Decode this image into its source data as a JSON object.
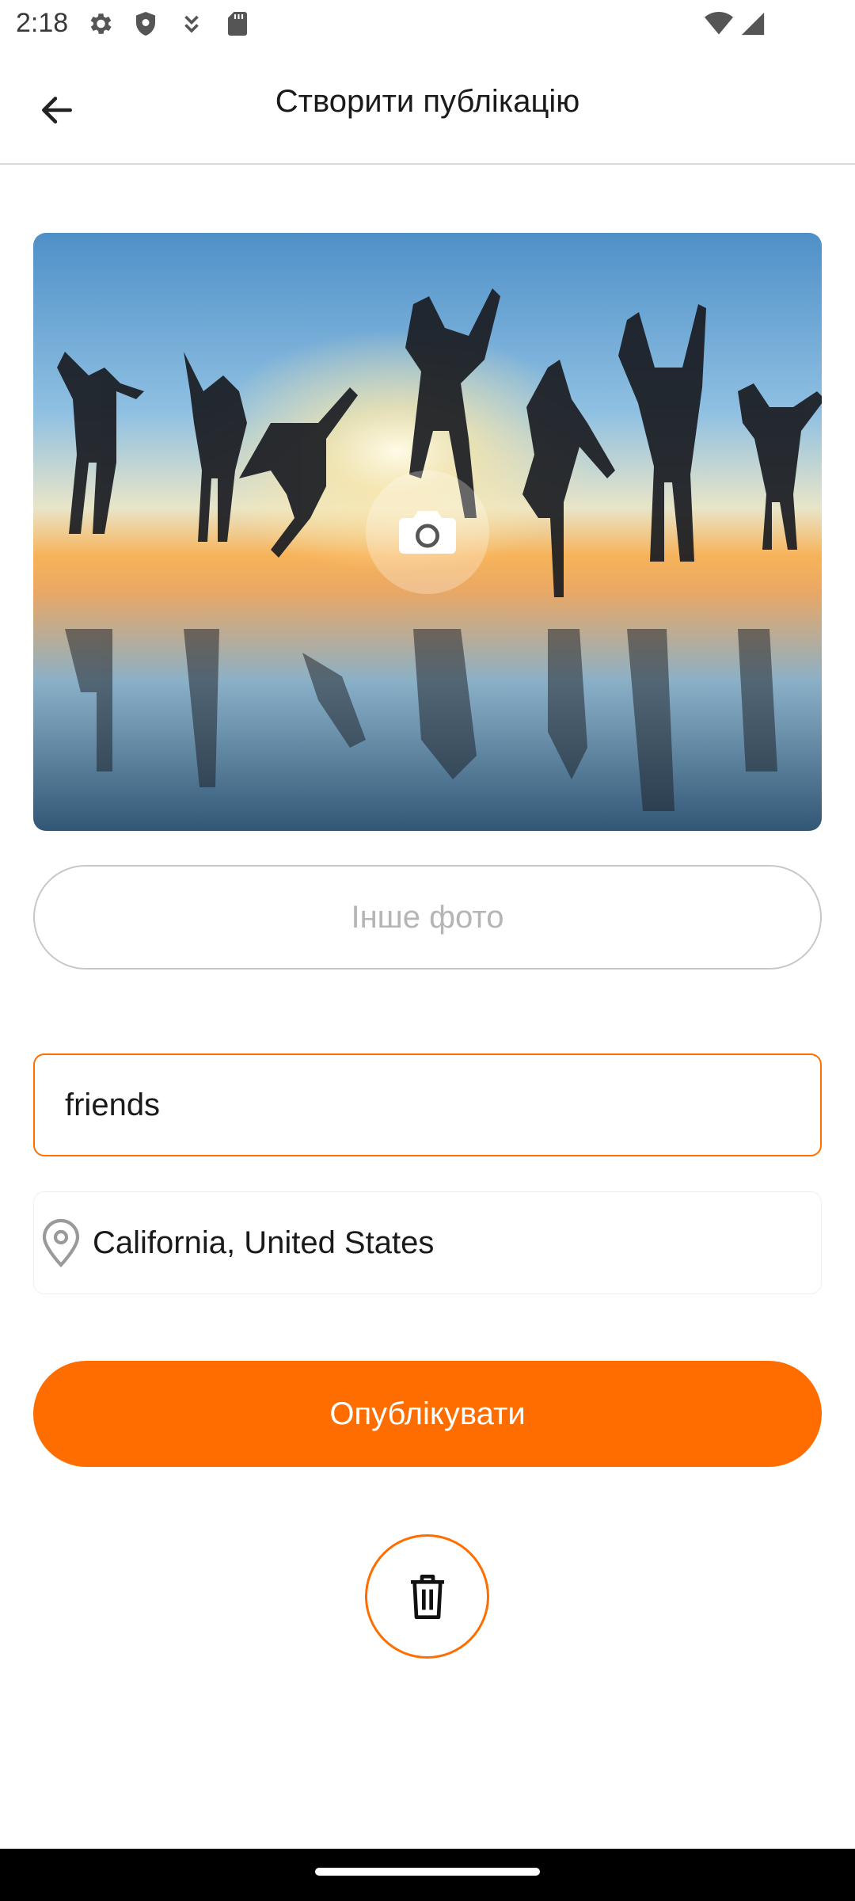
{
  "status_bar": {
    "time": "2:18",
    "icons": [
      "settings-icon",
      "shield-icon",
      "download-icon",
      "sd-card-icon",
      "wifi-icon",
      "signal-icon"
    ]
  },
  "app_bar": {
    "title": "Створити публікацію",
    "back_icon": "arrow-back-icon"
  },
  "photo": {
    "description_icon": "camera-icon"
  },
  "other_photo_button": {
    "label": "Інше фото"
  },
  "caption_field": {
    "value": "friends"
  },
  "location_field": {
    "value": "California, United States",
    "icon": "location-pin-icon"
  },
  "publish_button": {
    "label": "Опублікувати"
  },
  "delete_button": {
    "icon": "trash-icon"
  },
  "colors": {
    "accent": "#ff6d00",
    "border_gray": "#c8c8c8",
    "muted_text": "#b5b5b5"
  }
}
